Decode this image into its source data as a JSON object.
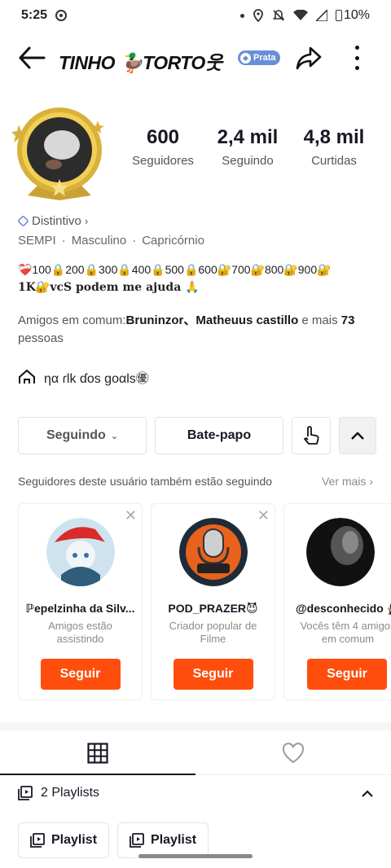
{
  "status": {
    "time": "5:25",
    "battery": "10%"
  },
  "header": {
    "title": "TINHO 🦆TORTO웃 ",
    "badge": "Prata"
  },
  "stats": [
    {
      "value": "600",
      "label": "Seguidores"
    },
    {
      "value": "2,4 mil",
      "label": "Seguindo"
    },
    {
      "value": "4,8 mil",
      "label": "Curtidas"
    }
  ],
  "profile": {
    "distintivo": "Distintivo",
    "tags": [
      "SEMPI",
      "Masculino",
      "Capricórnio"
    ],
    "bio_line1": "❤️‍🩹100🔒200🔒300🔒400🔒500🔒600🔐700🔐800🔐900🔐",
    "bio_line2": "1K🔐vcS podem me ajuda 🙏",
    "friends_prefix": "Amigos em comum:",
    "friends_names": "Bruninzor、Matheuus castillo",
    "friends_mid": " e mais ",
    "friends_count": "73",
    "friends_suffix": " pessoas",
    "link_text": "ηα ɾlk ɗos goαƖs㊝"
  },
  "actions": {
    "following": "Seguindo",
    "chat": "Bate-papo"
  },
  "suggestions": {
    "title": "Seguidores deste usuário também estão seguindo",
    "see_more": "Ver mais",
    "items": [
      {
        "name": "ℙepelzinha da Silv...",
        "desc": "Amigos estão assistindo",
        "button": "Seguir"
      },
      {
        "name": "POD_PRAZER😈",
        "desc": "Criador popular de Filme",
        "button": "Seguir"
      },
      {
        "name": "@desconhecido 🥷",
        "desc": "Vocês têm 4 amigos em comum",
        "button": "Seguir"
      }
    ]
  },
  "playlists": {
    "label": "2 Playlists",
    "items": [
      "Playlist",
      "Playlist"
    ]
  }
}
